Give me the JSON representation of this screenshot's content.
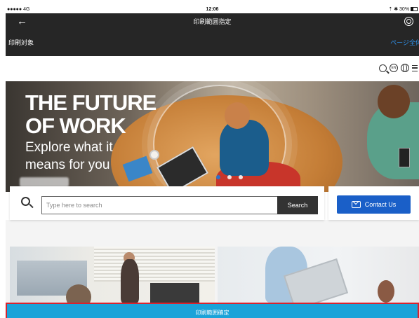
{
  "status_bar": {
    "carrier": "●●●●● 4G",
    "time": "12:06",
    "battery": "⇡ ✱ 30%"
  },
  "nav": {
    "back_glyph": "←",
    "title": "印刷範囲指定"
  },
  "sub_bar": {
    "label": "印刷対象",
    "link": "ページ全体"
  },
  "web_header": {
    "lang_badge": "EN"
  },
  "hero": {
    "headline_line1": "THE FUTURE",
    "headline_line2": "OF WORK",
    "sub_line1": "Explore what it",
    "sub_line2": "means for you"
  },
  "search": {
    "placeholder": "Type here to search",
    "button_label": "Search"
  },
  "contact": {
    "button_label": "Contact Us"
  },
  "confirm": {
    "label": "印刷範囲確定"
  },
  "colors": {
    "nav": "#262626",
    "link": "#2f8fe6",
    "contact_button": "#1a5fc8",
    "confirm_bar": "#1aa3d9",
    "confirm_border": "#d9232e"
  }
}
